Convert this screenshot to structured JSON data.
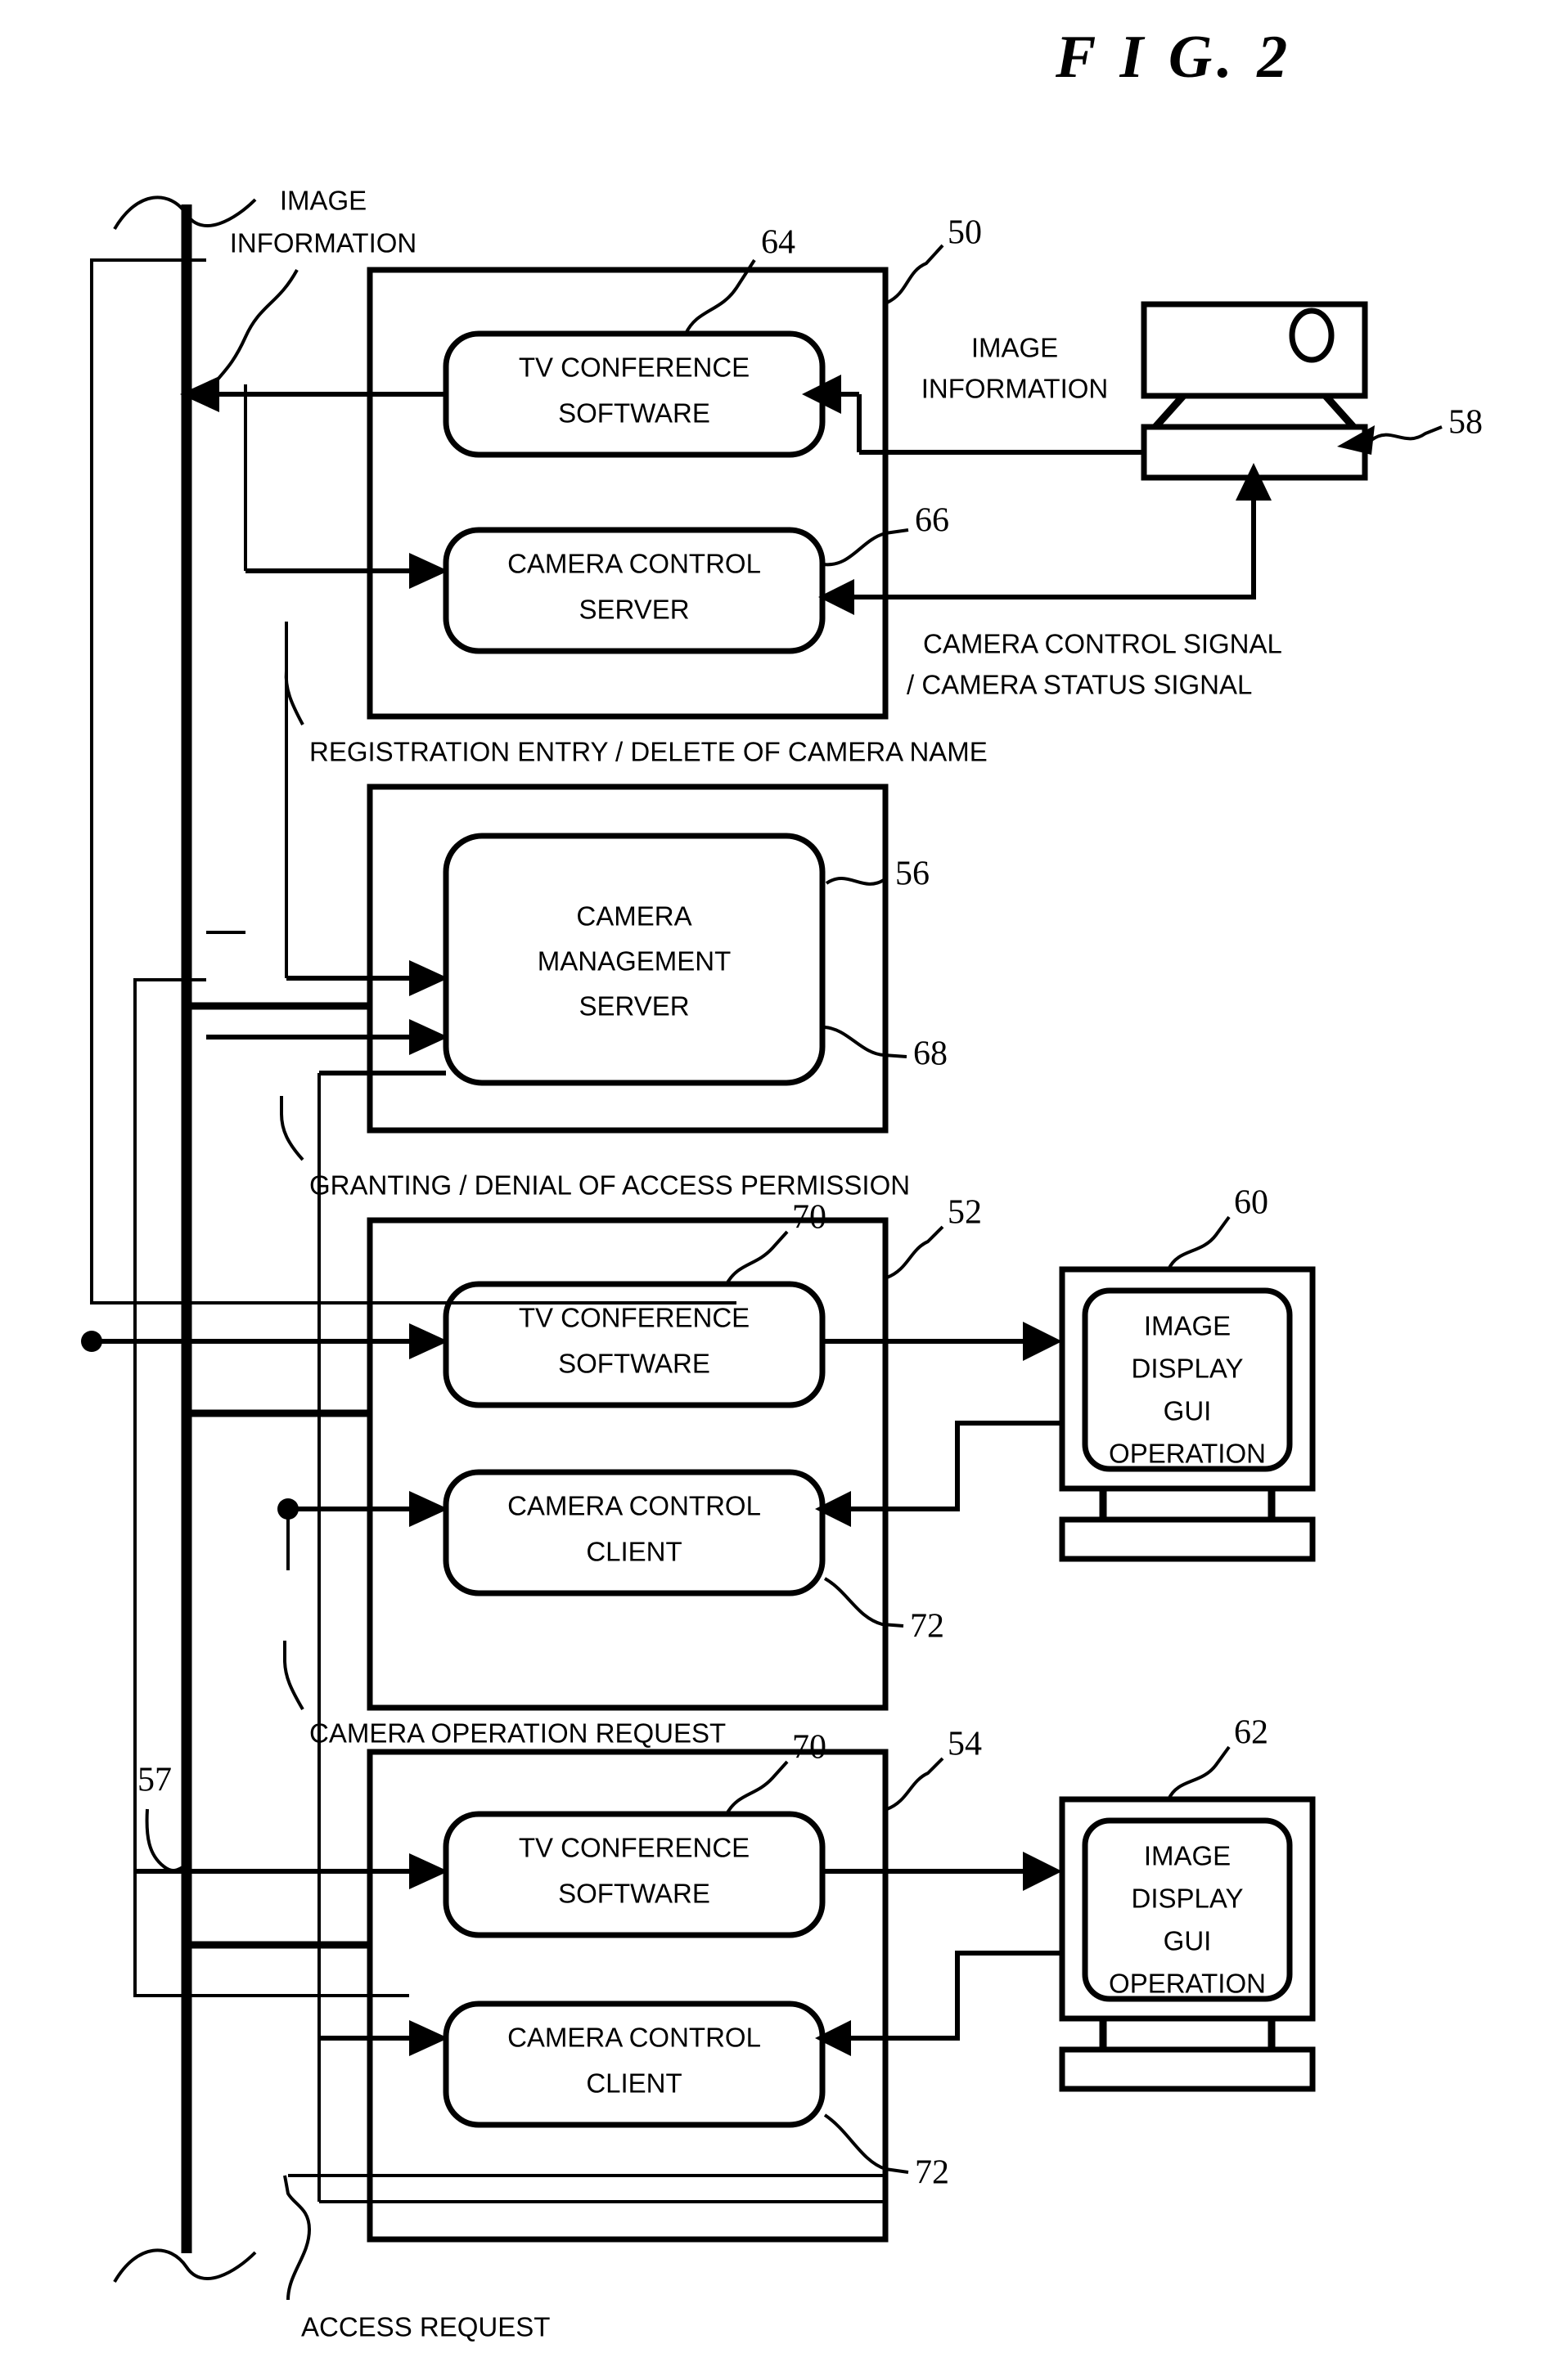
{
  "figure": {
    "title": "F I G.  2"
  },
  "annotations": {
    "image_information_top": "IMAGE\nINFORMATION",
    "image_information_top_l1": "IMAGE",
    "image_information_top_l2": "INFORMATION",
    "image_information_camera_l1": "IMAGE",
    "image_information_camera_l2": "INFORMATION",
    "camera_signal_l1": "CAMERA CONTROL SIGNAL",
    "camera_signal_l2": "/  CAMERA STATUS SIGNAL",
    "registration": "REGISTRATION ENTRY / DELETE OF CAMERA NAME",
    "granting": "GRANTING / DENIAL OF ACCESS PERMISSION",
    "camera_operation_request": "CAMERA OPERATION REQUEST",
    "access_request": "ACCESS REQUEST"
  },
  "blocks": {
    "server_host": {
      "ref": "50",
      "modules": [
        {
          "ref": "64",
          "line1": "TV CONFERENCE",
          "line2": "SOFTWARE"
        },
        {
          "ref": "66",
          "line1": "CAMERA CONTROL",
          "line2": "SERVER"
        }
      ]
    },
    "management_host": {
      "ref_top": "56",
      "ref_bottom": "68",
      "module": {
        "line1": "CAMERA",
        "line2": "MANAGEMENT",
        "line3": "SERVER"
      }
    },
    "client_host_1": {
      "ref": "52",
      "modules": [
        {
          "ref": "70",
          "line1": "TV CONFERENCE",
          "line2": "SOFTWARE"
        },
        {
          "ref": "72",
          "line1": "CAMERA CONTROL",
          "line2": "CLIENT"
        }
      ]
    },
    "client_host_2": {
      "ref": "54",
      "modules": [
        {
          "ref": "70",
          "line1": "TV CONFERENCE",
          "line2": "SOFTWARE"
        },
        {
          "ref": "72",
          "line1": "CAMERA CONTROL",
          "line2": "CLIENT"
        }
      ]
    }
  },
  "devices": {
    "camera": {
      "ref": "58",
      "name": "video-camera"
    },
    "monitor_1": {
      "ref": "60",
      "line1": "IMAGE",
      "line2": "DISPLAY",
      "line3": "GUI",
      "line4": "OPERATION"
    },
    "monitor_2": {
      "ref": "62",
      "line1": "IMAGE",
      "line2": "DISPLAY",
      "line3": "GUI",
      "line4": "OPERATION"
    }
  },
  "network": {
    "ref": "57",
    "name": "network-bus"
  },
  "colors": {
    "ink": "#000000",
    "paper": "#ffffff"
  }
}
